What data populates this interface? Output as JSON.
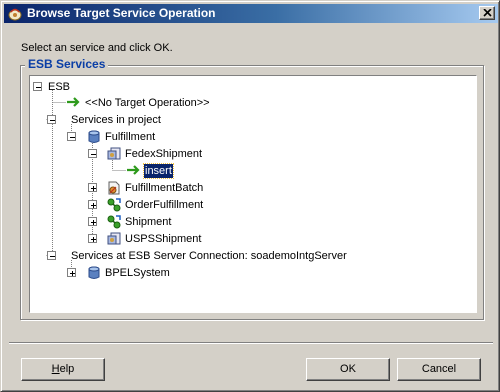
{
  "window": {
    "title": "Browse Target Service Operation",
    "title_icon": "jdeveloper-icon",
    "close_icon": "close-icon"
  },
  "instruction": "Select an service and click OK.",
  "group_title": "ESB Services",
  "tree": {
    "root": "ESB",
    "no_target": "<<No Target Operation>>",
    "services_in_project": "Services in project",
    "fulfillment": "Fulfillment",
    "fedex_shipment": "FedexShipment",
    "insert": "insert",
    "fulfillment_batch": "FulfillmentBatch",
    "order_fulfillment": "OrderFulfillment",
    "shipment": "Shipment",
    "usps_shipment": "USPSShipment",
    "server_connection": "Services at ESB Server Connection: soademoIntgServer",
    "bpel_system": "BPELSystem"
  },
  "buttons": {
    "help_mnemonic": "H",
    "help_rest": "elp",
    "ok": "OK",
    "cancel": "Cancel"
  },
  "colors": {
    "selection": "#0a246a",
    "group_title": "#0a3ea6",
    "operation_arrow": "#2e9a1c"
  }
}
